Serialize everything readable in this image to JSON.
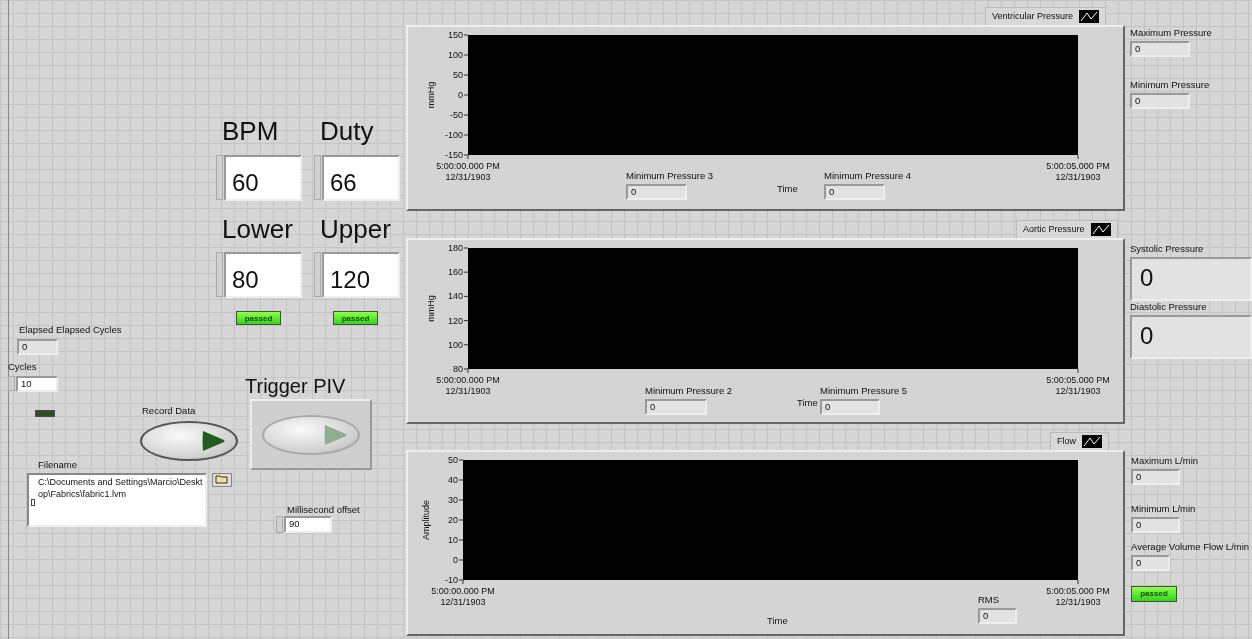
{
  "numeric_controls": [
    {
      "label": "BPM",
      "value": "60"
    },
    {
      "label": "Duty",
      "value": "66"
    },
    {
      "label": "Lower",
      "value": "80"
    },
    {
      "label": "Upper",
      "value": "120"
    }
  ],
  "range_leds": [
    {
      "text": "passed",
      "on": true
    },
    {
      "text": "passed",
      "on": true
    }
  ],
  "elapsed": {
    "label": "Elapsed Elapsed Cycles",
    "value": "0"
  },
  "cycles": {
    "label": "Cycles",
    "value": "10"
  },
  "status_led": {
    "on": false
  },
  "record_button": {
    "label": "Record Data",
    "disabled": false
  },
  "trigger_button": {
    "label": "Trigger PIV",
    "disabled": true
  },
  "filename": {
    "label": "Filename",
    "value": "C:\\Documents and Settings\\Marcio\\Desktop\\Fabrics\\fabric1.lvm"
  },
  "millisecond_offset": {
    "label": "Millisecond offset",
    "value": "90"
  },
  "graphs": [
    {
      "legend": "Ventricular Pressure",
      "chart_data": {
        "type": "line",
        "xlabel": "Time",
        "ylabel": "mmHg",
        "ylim": [
          -150,
          150
        ],
        "yticks": [
          -150,
          -100,
          -50,
          0,
          50,
          100,
          150
        ],
        "categories": [
          "5:00:00.000 PM\n12/31/1903",
          "5:00:05.000 PM\n12/31/1903"
        ]
      },
      "indicators": [
        {
          "label": "Minimum Pressure 3",
          "value": "0"
        },
        {
          "label": "Minimum Pressure 4",
          "value": "0"
        }
      ]
    },
    {
      "legend": "Aortic Pressure",
      "chart_data": {
        "type": "line",
        "xlabel": "Time",
        "ylabel": "mmHg",
        "ylim": [
          80,
          180
        ],
        "yticks": [
          80,
          100,
          120,
          140,
          160,
          180
        ],
        "categories": [
          "5:00:00.000 PM\n12/31/1903",
          "5:00:05.000 PM\n12/31/1903"
        ]
      },
      "indicators": [
        {
          "label": "Minimum Pressure 2",
          "value": "0"
        },
        {
          "label": "Minimum Pressure 5",
          "value": "0"
        }
      ]
    },
    {
      "legend": "Flow",
      "chart_data": {
        "type": "line",
        "xlabel": "Time",
        "ylabel": "Amplitude",
        "ylim": [
          -10,
          50
        ],
        "yticks": [
          -10,
          0,
          10,
          20,
          30,
          40,
          50
        ],
        "categories": [
          "5:00:00.000 PM\n12/31/1903",
          "5:00:05.000 PM\n12/31/1903"
        ]
      },
      "indicators": [
        {
          "label": "RMS",
          "value": "0"
        }
      ]
    }
  ],
  "right_indicators": [
    {
      "label": "Maximum Pressure",
      "value": "0",
      "kind": "small"
    },
    {
      "label": "Minimum Pressure",
      "value": "0",
      "kind": "small"
    },
    {
      "label": "Systolic Pressure",
      "value": "0",
      "kind": "large"
    },
    {
      "label": "Diastolic Pressure",
      "value": "0",
      "kind": "large"
    },
    {
      "label": "Maximum L/min",
      "value": "0",
      "kind": "small"
    },
    {
      "label": "Minimum L/min",
      "value": "0",
      "kind": "small"
    },
    {
      "label": "Average Volume Flow L/min",
      "value": "0",
      "kind": "small"
    }
  ],
  "flow_led": {
    "text": "passed",
    "on": true
  }
}
